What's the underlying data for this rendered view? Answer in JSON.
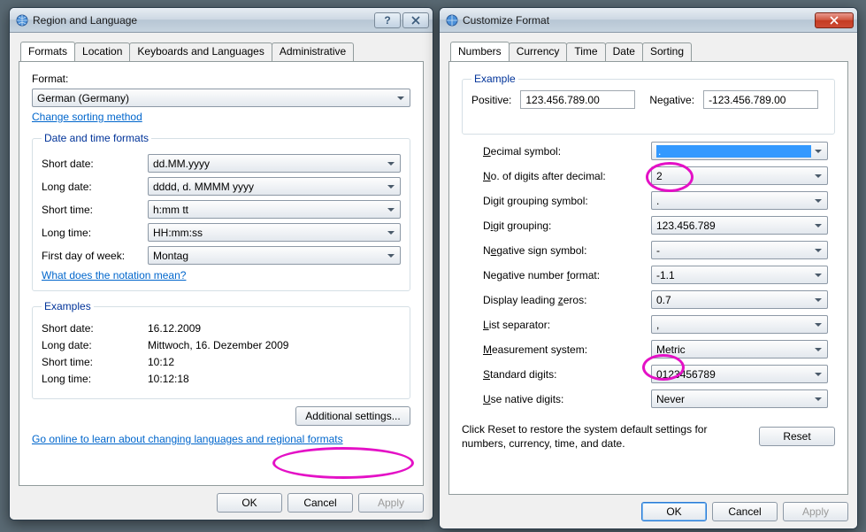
{
  "left": {
    "title": "Region and Language",
    "tabs": [
      "Formats",
      "Location",
      "Keyboards and Languages",
      "Administrative"
    ],
    "format_label": "Format:",
    "format_value": "German (Germany)",
    "change_sorting": "Change sorting method",
    "dt_group": "Date and time formats",
    "short_date_lbl": "Short date:",
    "short_date_val": "dd.MM.yyyy",
    "long_date_lbl": "Long date:",
    "long_date_val": "dddd, d. MMMM yyyy",
    "short_time_lbl": "Short time:",
    "short_time_val": "h:mm tt",
    "long_time_lbl": "Long time:",
    "long_time_val": "HH:mm:ss",
    "first_day_lbl": "First day of week:",
    "first_day_val": "Montag",
    "notation_link": "What does the notation mean?",
    "ex_group": "Examples",
    "ex_short_date_lbl": "Short date:",
    "ex_short_date_val": "16.12.2009",
    "ex_long_date_lbl": "Long date:",
    "ex_long_date_val": "Mittwoch, 16. Dezember 2009",
    "ex_short_time_lbl": "Short time:",
    "ex_short_time_val": "10:12",
    "ex_long_time_lbl": "Long time:",
    "ex_long_time_val": "10:12:18",
    "additional_settings": "Additional settings...",
    "go_online": "Go online to learn about changing languages and regional formats",
    "ok": "OK",
    "cancel": "Cancel",
    "apply": "Apply"
  },
  "right": {
    "title": "Customize Format",
    "tabs": [
      "Numbers",
      "Currency",
      "Time",
      "Date",
      "Sorting"
    ],
    "example_group": "Example",
    "positive_lbl": "Positive:",
    "positive_val": "123.456.789.00",
    "negative_lbl": "Negative:",
    "negative_val": "-123.456.789.00",
    "decimal_symbol_lbl": "Decimal symbol:",
    "decimal_symbol_val": ".",
    "digits_after_lbl": "No. of digits after decimal:",
    "digits_after_val": "2",
    "group_symbol_lbl": "Digit grouping symbol:",
    "group_symbol_val": ".",
    "grouping_lbl": "Digit grouping:",
    "grouping_val": "123.456.789",
    "neg_symbol_lbl": "Negative sign symbol:",
    "neg_symbol_val": "-",
    "neg_format_lbl": "Negative number format:",
    "neg_format_val": "-1.1",
    "leading_zero_lbl": "Display leading zeros:",
    "leading_zero_val": "0.7",
    "list_sep_lbl": "List separator:",
    "list_sep_val": ",",
    "measure_lbl": "Measurement system:",
    "measure_val": "Metric",
    "std_digits_lbl": "Standard digits:",
    "std_digits_val": "0123456789",
    "native_digits_lbl": "Use native digits:",
    "native_digits_val": "Never",
    "reset_text": "Click Reset to restore the system default settings for numbers, currency, time, and date.",
    "reset": "Reset",
    "ok": "OK",
    "cancel": "Cancel",
    "apply": "Apply"
  }
}
